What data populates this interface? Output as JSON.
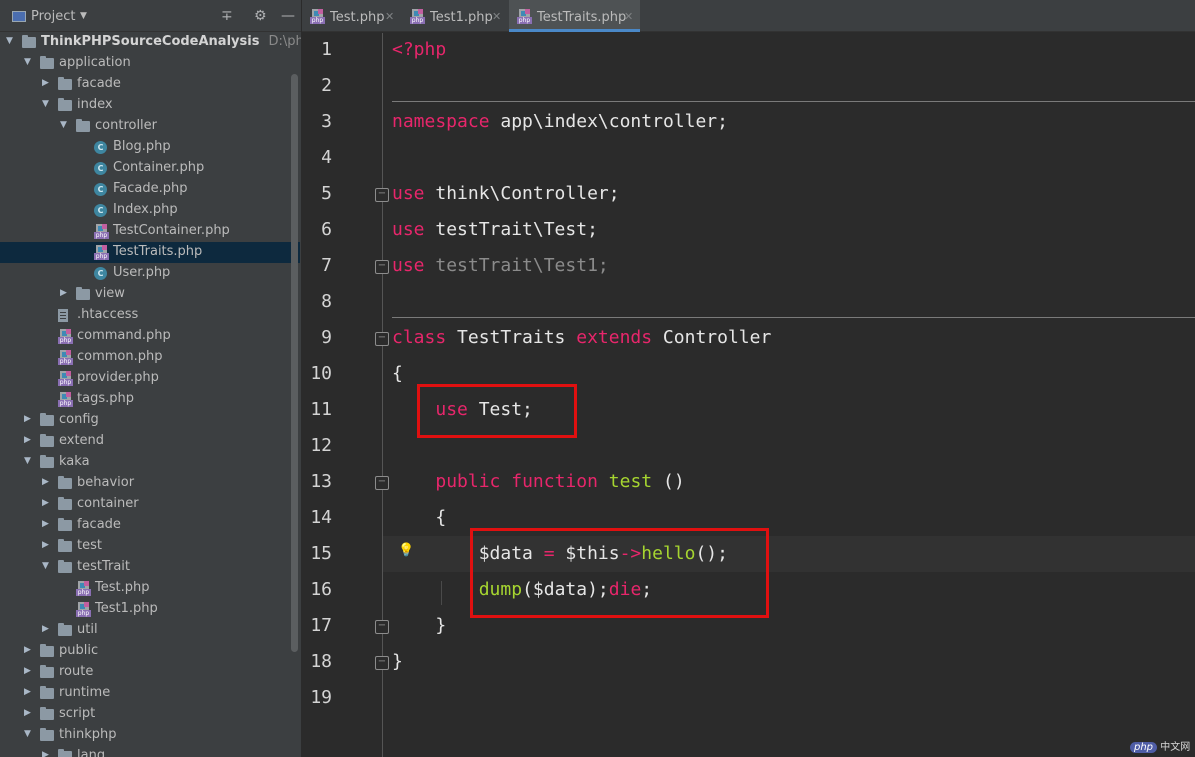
{
  "project_panel": {
    "title": "Project",
    "root": {
      "name": "ThinkPHPSourceCodeAnalysis",
      "path": "D:\\phpstudy"
    },
    "tree": [
      {
        "label": "application",
        "type": "folder",
        "depth": 1,
        "expanded": true
      },
      {
        "label": "facade",
        "type": "folder",
        "depth": 2,
        "expanded": false
      },
      {
        "label": "index",
        "type": "folder",
        "depth": 2,
        "expanded": true
      },
      {
        "label": "controller",
        "type": "folder",
        "depth": 3,
        "expanded": true
      },
      {
        "label": "Blog.php",
        "type": "class",
        "depth": 4
      },
      {
        "label": "Container.php",
        "type": "class",
        "depth": 4
      },
      {
        "label": "Facade.php",
        "type": "class",
        "depth": 4
      },
      {
        "label": "Index.php",
        "type": "class",
        "depth": 4
      },
      {
        "label": "TestContainer.php",
        "type": "php",
        "depth": 4
      },
      {
        "label": "TestTraits.php",
        "type": "php",
        "depth": 4,
        "selected": true
      },
      {
        "label": "User.php",
        "type": "class",
        "depth": 4
      },
      {
        "label": "view",
        "type": "folder",
        "depth": 3,
        "expanded": false
      },
      {
        "label": ".htaccess",
        "type": "htaccess",
        "depth": 2
      },
      {
        "label": "command.php",
        "type": "php",
        "depth": 2
      },
      {
        "label": "common.php",
        "type": "php",
        "depth": 2
      },
      {
        "label": "provider.php",
        "type": "php",
        "depth": 2
      },
      {
        "label": "tags.php",
        "type": "php",
        "depth": 2
      },
      {
        "label": "config",
        "type": "folder",
        "depth": 1,
        "expanded": false
      },
      {
        "label": "extend",
        "type": "folder",
        "depth": 1,
        "expanded": false
      },
      {
        "label": "kaka",
        "type": "folder",
        "depth": 1,
        "expanded": true
      },
      {
        "label": "behavior",
        "type": "folder",
        "depth": 2,
        "expanded": false
      },
      {
        "label": "container",
        "type": "folder",
        "depth": 2,
        "expanded": false
      },
      {
        "label": "facade",
        "type": "folder",
        "depth": 2,
        "expanded": false
      },
      {
        "label": "test",
        "type": "folder",
        "depth": 2,
        "expanded": false
      },
      {
        "label": "testTrait",
        "type": "folder",
        "depth": 2,
        "expanded": true
      },
      {
        "label": "Test.php",
        "type": "php",
        "depth": 3
      },
      {
        "label": "Test1.php",
        "type": "php",
        "depth": 3
      },
      {
        "label": "util",
        "type": "folder",
        "depth": 2,
        "expanded": false
      },
      {
        "label": "public",
        "type": "folder",
        "depth": 1,
        "expanded": false
      },
      {
        "label": "route",
        "type": "folder",
        "depth": 1,
        "expanded": false
      },
      {
        "label": "runtime",
        "type": "folder",
        "depth": 1,
        "expanded": false
      },
      {
        "label": "script",
        "type": "folder",
        "depth": 1,
        "expanded": false
      },
      {
        "label": "thinkphp",
        "type": "folder",
        "depth": 1,
        "expanded": true
      },
      {
        "label": "lang",
        "type": "folder",
        "depth": 2,
        "expanded": false
      }
    ]
  },
  "tabs": [
    {
      "label": "Test.php",
      "active": false
    },
    {
      "label": "Test1.php",
      "active": false
    },
    {
      "label": "TestTraits.php",
      "active": true
    }
  ],
  "editor": {
    "line_numbers": [
      "1",
      "2",
      "3",
      "4",
      "5",
      "6",
      "7",
      "8",
      "9",
      "10",
      "11",
      "12",
      "13",
      "14",
      "15",
      "16",
      "17",
      "18",
      "19"
    ],
    "lines": {
      "l1": {
        "open": "<?php"
      },
      "l3": {
        "kw": "namespace",
        "rest": " app\\index\\controller;"
      },
      "l5": {
        "kw": "use",
        "rest": " think\\Controller;"
      },
      "l6": {
        "kw": "use",
        "rest": " testTrait\\Test;"
      },
      "l7": {
        "kw": "use",
        "rest": " testTrait\\Test1;"
      },
      "l9": {
        "kw1": "class",
        "mid": " TestTraits ",
        "kw2": "extends",
        "rest": " Controller"
      },
      "l10": {
        "text": "{"
      },
      "l11": {
        "indent": "    ",
        "kw": "use",
        "rest": " Test;"
      },
      "l13": {
        "indent": "    ",
        "kw1": "public",
        "kw2": "function",
        "fn": "test",
        "rest": " ()"
      },
      "l14": {
        "text": "    {"
      },
      "l15": {
        "a": "        $data ",
        "eq": "=",
        "b": " $this",
        "arrow": "->",
        "fn": "hello",
        "c": "();"
      },
      "l16": {
        "indent": "        ",
        "fn": "dump",
        "a": "($data);",
        "kw": "die",
        "b": ";"
      },
      "l17": {
        "text": "    }"
      },
      "l18": {
        "text": "}"
      }
    }
  },
  "watermark": {
    "logo": "php",
    "text": "中文网"
  }
}
